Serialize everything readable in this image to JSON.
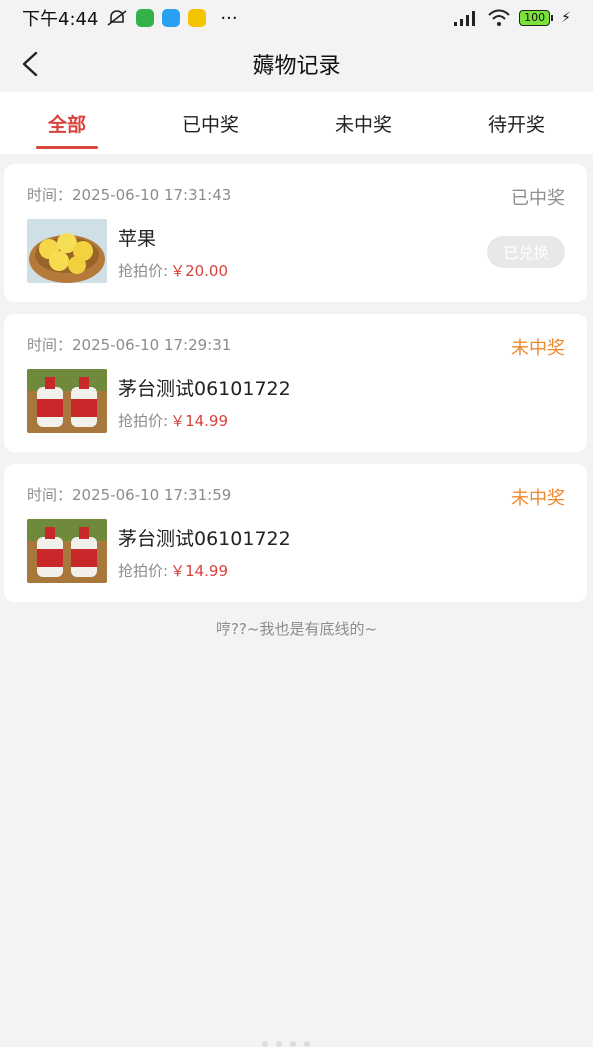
{
  "status_bar": {
    "time": "下午4:44",
    "dots": "···",
    "battery": "100"
  },
  "nav": {
    "title": "薅物记录"
  },
  "tabs": [
    {
      "label": "全部",
      "active": true
    },
    {
      "label": "已中奖",
      "active": false
    },
    {
      "label": "未中奖",
      "active": false
    },
    {
      "label": "待开奖",
      "active": false
    }
  ],
  "records": [
    {
      "time_label": "时间：",
      "time": "2025-06-10 17:31:43",
      "status": "已中奖",
      "name": "苹果",
      "price_label": "抢拍价:",
      "price": "￥20.00",
      "action": "已兑换"
    },
    {
      "time_label": "时间：",
      "time": "2025-06-10 17:29:31",
      "status": "未中奖",
      "name": "茅台测试06101722",
      "price_label": "抢拍价:",
      "price": "￥14.99"
    },
    {
      "time_label": "时间：",
      "time": "2025-06-10 17:31:59",
      "status": "未中奖",
      "name": "茅台测试06101722",
      "price_label": "抢拍价:",
      "price": "￥14.99"
    }
  ],
  "footer": {
    "note": "哼??~我也是有底线的~"
  },
  "colors": {
    "accent": "#d7433d",
    "lost": "#f0882c",
    "muted": "#8c8c8c"
  }
}
